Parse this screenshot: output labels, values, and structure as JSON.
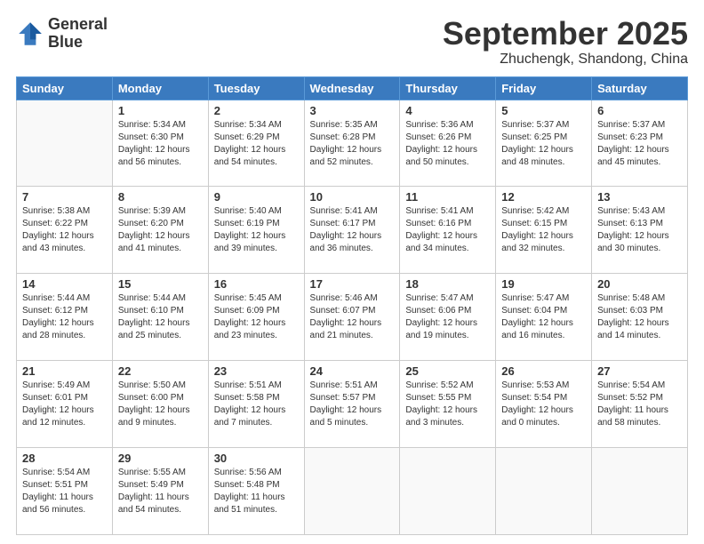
{
  "header": {
    "logo_line1": "General",
    "logo_line2": "Blue",
    "month": "September 2025",
    "location": "Zhuchengk, Shandong, China"
  },
  "days_of_week": [
    "Sunday",
    "Monday",
    "Tuesday",
    "Wednesday",
    "Thursday",
    "Friday",
    "Saturday"
  ],
  "weeks": [
    [
      {
        "day": "",
        "info": ""
      },
      {
        "day": "1",
        "info": "Sunrise: 5:34 AM\nSunset: 6:30 PM\nDaylight: 12 hours\nand 56 minutes."
      },
      {
        "day": "2",
        "info": "Sunrise: 5:34 AM\nSunset: 6:29 PM\nDaylight: 12 hours\nand 54 minutes."
      },
      {
        "day": "3",
        "info": "Sunrise: 5:35 AM\nSunset: 6:28 PM\nDaylight: 12 hours\nand 52 minutes."
      },
      {
        "day": "4",
        "info": "Sunrise: 5:36 AM\nSunset: 6:26 PM\nDaylight: 12 hours\nand 50 minutes."
      },
      {
        "day": "5",
        "info": "Sunrise: 5:37 AM\nSunset: 6:25 PM\nDaylight: 12 hours\nand 48 minutes."
      },
      {
        "day": "6",
        "info": "Sunrise: 5:37 AM\nSunset: 6:23 PM\nDaylight: 12 hours\nand 45 minutes."
      }
    ],
    [
      {
        "day": "7",
        "info": "Sunrise: 5:38 AM\nSunset: 6:22 PM\nDaylight: 12 hours\nand 43 minutes."
      },
      {
        "day": "8",
        "info": "Sunrise: 5:39 AM\nSunset: 6:20 PM\nDaylight: 12 hours\nand 41 minutes."
      },
      {
        "day": "9",
        "info": "Sunrise: 5:40 AM\nSunset: 6:19 PM\nDaylight: 12 hours\nand 39 minutes."
      },
      {
        "day": "10",
        "info": "Sunrise: 5:41 AM\nSunset: 6:17 PM\nDaylight: 12 hours\nand 36 minutes."
      },
      {
        "day": "11",
        "info": "Sunrise: 5:41 AM\nSunset: 6:16 PM\nDaylight: 12 hours\nand 34 minutes."
      },
      {
        "day": "12",
        "info": "Sunrise: 5:42 AM\nSunset: 6:15 PM\nDaylight: 12 hours\nand 32 minutes."
      },
      {
        "day": "13",
        "info": "Sunrise: 5:43 AM\nSunset: 6:13 PM\nDaylight: 12 hours\nand 30 minutes."
      }
    ],
    [
      {
        "day": "14",
        "info": "Sunrise: 5:44 AM\nSunset: 6:12 PM\nDaylight: 12 hours\nand 28 minutes."
      },
      {
        "day": "15",
        "info": "Sunrise: 5:44 AM\nSunset: 6:10 PM\nDaylight: 12 hours\nand 25 minutes."
      },
      {
        "day": "16",
        "info": "Sunrise: 5:45 AM\nSunset: 6:09 PM\nDaylight: 12 hours\nand 23 minutes."
      },
      {
        "day": "17",
        "info": "Sunrise: 5:46 AM\nSunset: 6:07 PM\nDaylight: 12 hours\nand 21 minutes."
      },
      {
        "day": "18",
        "info": "Sunrise: 5:47 AM\nSunset: 6:06 PM\nDaylight: 12 hours\nand 19 minutes."
      },
      {
        "day": "19",
        "info": "Sunrise: 5:47 AM\nSunset: 6:04 PM\nDaylight: 12 hours\nand 16 minutes."
      },
      {
        "day": "20",
        "info": "Sunrise: 5:48 AM\nSunset: 6:03 PM\nDaylight: 12 hours\nand 14 minutes."
      }
    ],
    [
      {
        "day": "21",
        "info": "Sunrise: 5:49 AM\nSunset: 6:01 PM\nDaylight: 12 hours\nand 12 minutes."
      },
      {
        "day": "22",
        "info": "Sunrise: 5:50 AM\nSunset: 6:00 PM\nDaylight: 12 hours\nand 9 minutes."
      },
      {
        "day": "23",
        "info": "Sunrise: 5:51 AM\nSunset: 5:58 PM\nDaylight: 12 hours\nand 7 minutes."
      },
      {
        "day": "24",
        "info": "Sunrise: 5:51 AM\nSunset: 5:57 PM\nDaylight: 12 hours\nand 5 minutes."
      },
      {
        "day": "25",
        "info": "Sunrise: 5:52 AM\nSunset: 5:55 PM\nDaylight: 12 hours\nand 3 minutes."
      },
      {
        "day": "26",
        "info": "Sunrise: 5:53 AM\nSunset: 5:54 PM\nDaylight: 12 hours\nand 0 minutes."
      },
      {
        "day": "27",
        "info": "Sunrise: 5:54 AM\nSunset: 5:52 PM\nDaylight: 11 hours\nand 58 minutes."
      }
    ],
    [
      {
        "day": "28",
        "info": "Sunrise: 5:54 AM\nSunset: 5:51 PM\nDaylight: 11 hours\nand 56 minutes."
      },
      {
        "day": "29",
        "info": "Sunrise: 5:55 AM\nSunset: 5:49 PM\nDaylight: 11 hours\nand 54 minutes."
      },
      {
        "day": "30",
        "info": "Sunrise: 5:56 AM\nSunset: 5:48 PM\nDaylight: 11 hours\nand 51 minutes."
      },
      {
        "day": "",
        "info": ""
      },
      {
        "day": "",
        "info": ""
      },
      {
        "day": "",
        "info": ""
      },
      {
        "day": "",
        "info": ""
      }
    ]
  ]
}
